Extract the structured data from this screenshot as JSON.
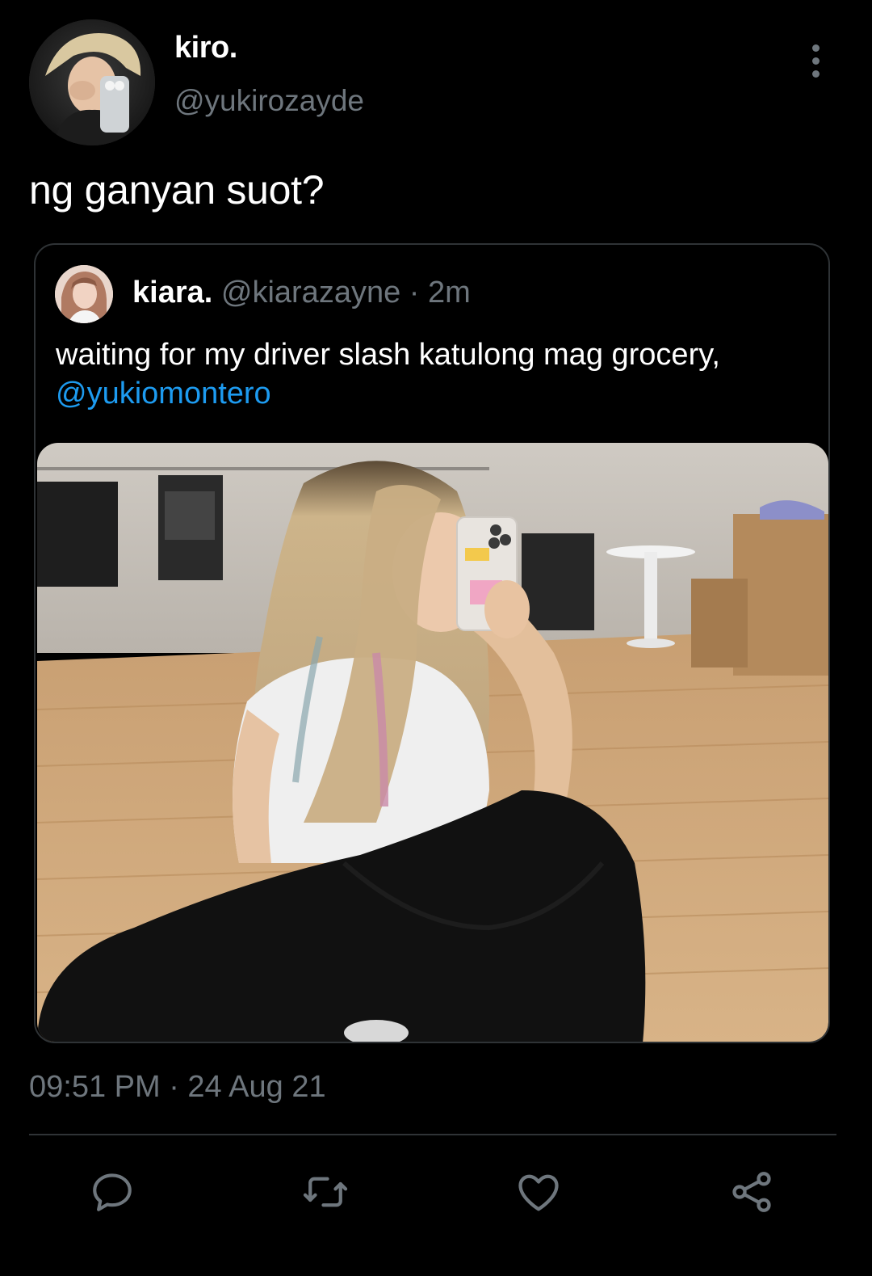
{
  "author": {
    "display_name": "kiro.",
    "handle": "@yukirozayde"
  },
  "tweet": {
    "text": "ng ganyan suot?",
    "timestamp": "09:51 PM · 24 Aug 21"
  },
  "quoted_tweet": {
    "display_name": "kiara.",
    "handle": "@kiarazayne",
    "separator": "·",
    "time": "2m",
    "text": "waiting for my driver slash katulong mag grocery,",
    "mention": "@yukiomontero"
  },
  "actions": {
    "icons": [
      "reply-icon",
      "retweet-icon",
      "like-icon",
      "share-icon"
    ]
  },
  "colors": {
    "background": "#000000",
    "secondary_text": "#6e767d",
    "border": "#2f3336",
    "link": "#1d9bf0"
  }
}
